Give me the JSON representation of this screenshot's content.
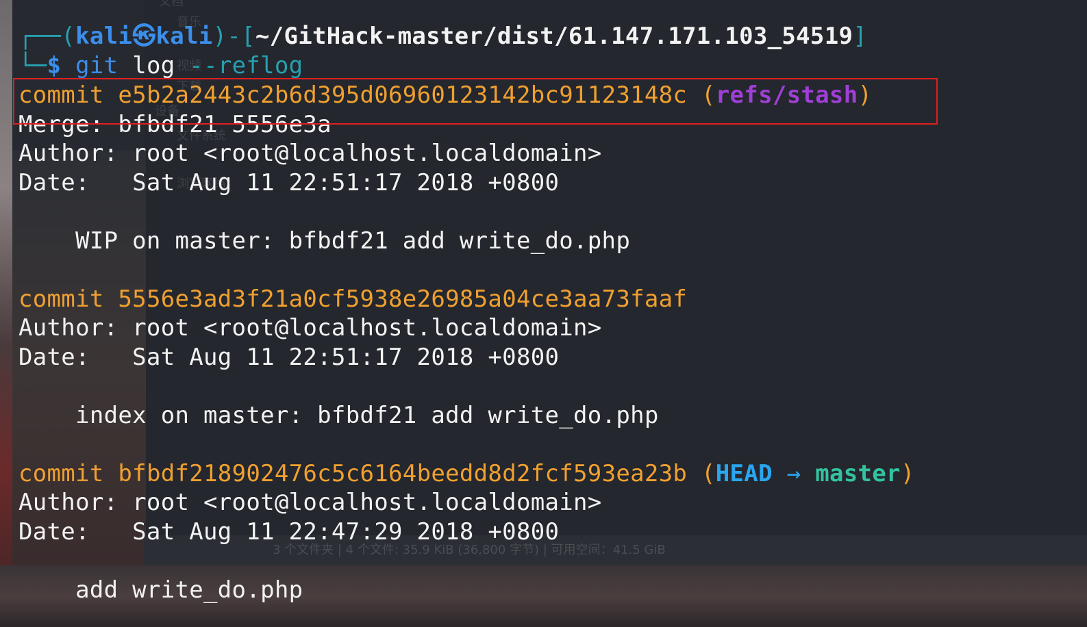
{
  "background": {
    "sidebar_items": [
      "文档",
      "音乐",
      "视频",
      "下载",
      "设备",
      "文件系统",
      "浏览网络"
    ],
    "status_bar": "3 个文件夹 | 4 个文件: 35.9 KiB (36,800 字节) | 可用空间：41.5 GiB"
  },
  "prompt": {
    "frame_top": "┌──(",
    "user": "kali",
    "icon": "㉿",
    "host": "kali",
    "frame_mid": ")-[",
    "path": "~/GitHack-master/dist/61.147.171.103_54519",
    "frame_end": "]",
    "frame_bottom": "└─",
    "dollar": "$",
    "cmd": "git",
    "sub": "log",
    "arg": "--reflog"
  },
  "commits": [
    {
      "label": "commit",
      "hash": "e5b2a2443c2b6d395d06960123142bc91123148c",
      "ref": "refs/stash",
      "merge": "Merge: bfbdf21 5556e3a",
      "author": "Author: root <root@localhost.localdomain>",
      "date": "Date:   Sat Aug 11 22:51:17 2018 +0800",
      "message": "    WIP on master: bfbdf21 add write_do.php"
    },
    {
      "label": "commit",
      "hash": "5556e3ad3f21a0cf5938e26985a04ce3aa73faaf",
      "author": "Author: root <root@localhost.localdomain>",
      "date": "Date:   Sat Aug 11 22:51:17 2018 +0800",
      "message": "    index on master: bfbdf21 add write_do.php"
    },
    {
      "label": "commit",
      "hash": "bfbdf218902476c5c6164beedd8d2fcf593ea23b",
      "head": "HEAD",
      "arrow": "→",
      "branch": "master",
      "author": "Author: root <root@localhost.localdomain>",
      "date": "Date:   Sat Aug 11 22:47:29 2018 +0800",
      "message": "    add write_do.php"
    }
  ],
  "colors": {
    "terminal_bg": "#262930",
    "commit": "#f0a030",
    "stash_ref": "#a03fd8",
    "head": "#2aa6f0",
    "branch": "#33c2a0",
    "prompt_user": "#3b8eea",
    "highlight": "#e02020"
  }
}
